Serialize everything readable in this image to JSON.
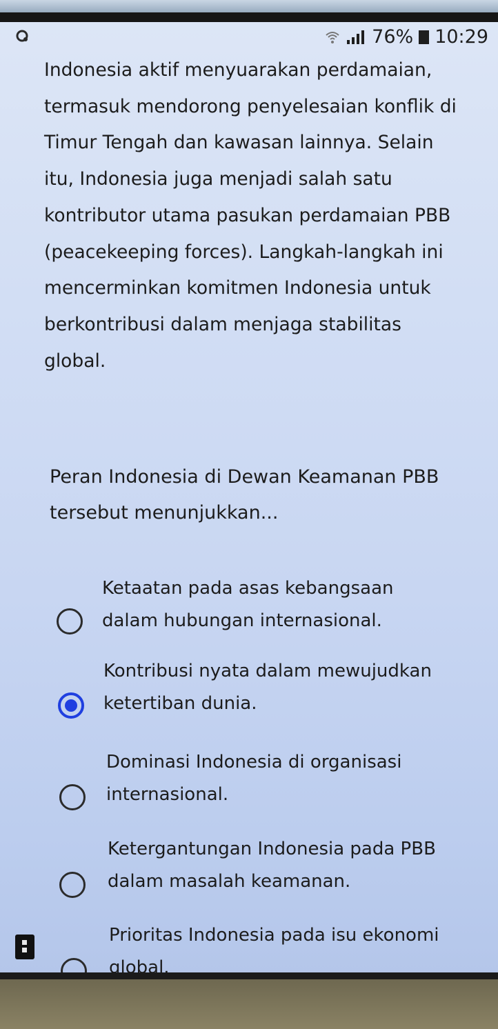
{
  "status_bar": {
    "battery": "76%",
    "time": "10:29",
    "icons": [
      "notification-icon",
      "wifi-icon",
      "signal-icon",
      "battery-icon"
    ]
  },
  "passage": "Indonesia aktif menyuarakan perdamaian, termasuk mendorong penyelesaian konflik di Timur Tengah dan kawasan lainnya. Selain itu, Indonesia juga menjadi salah satu kontributor utama pasukan perdamaian PBB (peacekeeping forces). Langkah-langkah ini mencerminkan komitmen Indonesia untuk berkontribusi dalam menjaga stabilitas global.",
  "question": "Peran Indonesia di Dewan Keamanan PBB tersebut menunjukkan...",
  "options": [
    {
      "label": "Ketaatan pada asas kebangsaan dalam hubungan internasional.",
      "selected": false
    },
    {
      "label": "Kontribusi nyata dalam mewujudkan ketertiban dunia.",
      "selected": true
    },
    {
      "label": "Dominasi Indonesia di organisasi internasional.",
      "selected": false
    },
    {
      "label": "Ketergantungan Indonesia pada PBB dalam masalah keamanan.",
      "selected": false
    },
    {
      "label": "Prioritas Indonesia pada isu ekonomi global.",
      "selected": false
    }
  ],
  "colors": {
    "accent": "#1f3fe0",
    "text": "#1c1c1c"
  }
}
